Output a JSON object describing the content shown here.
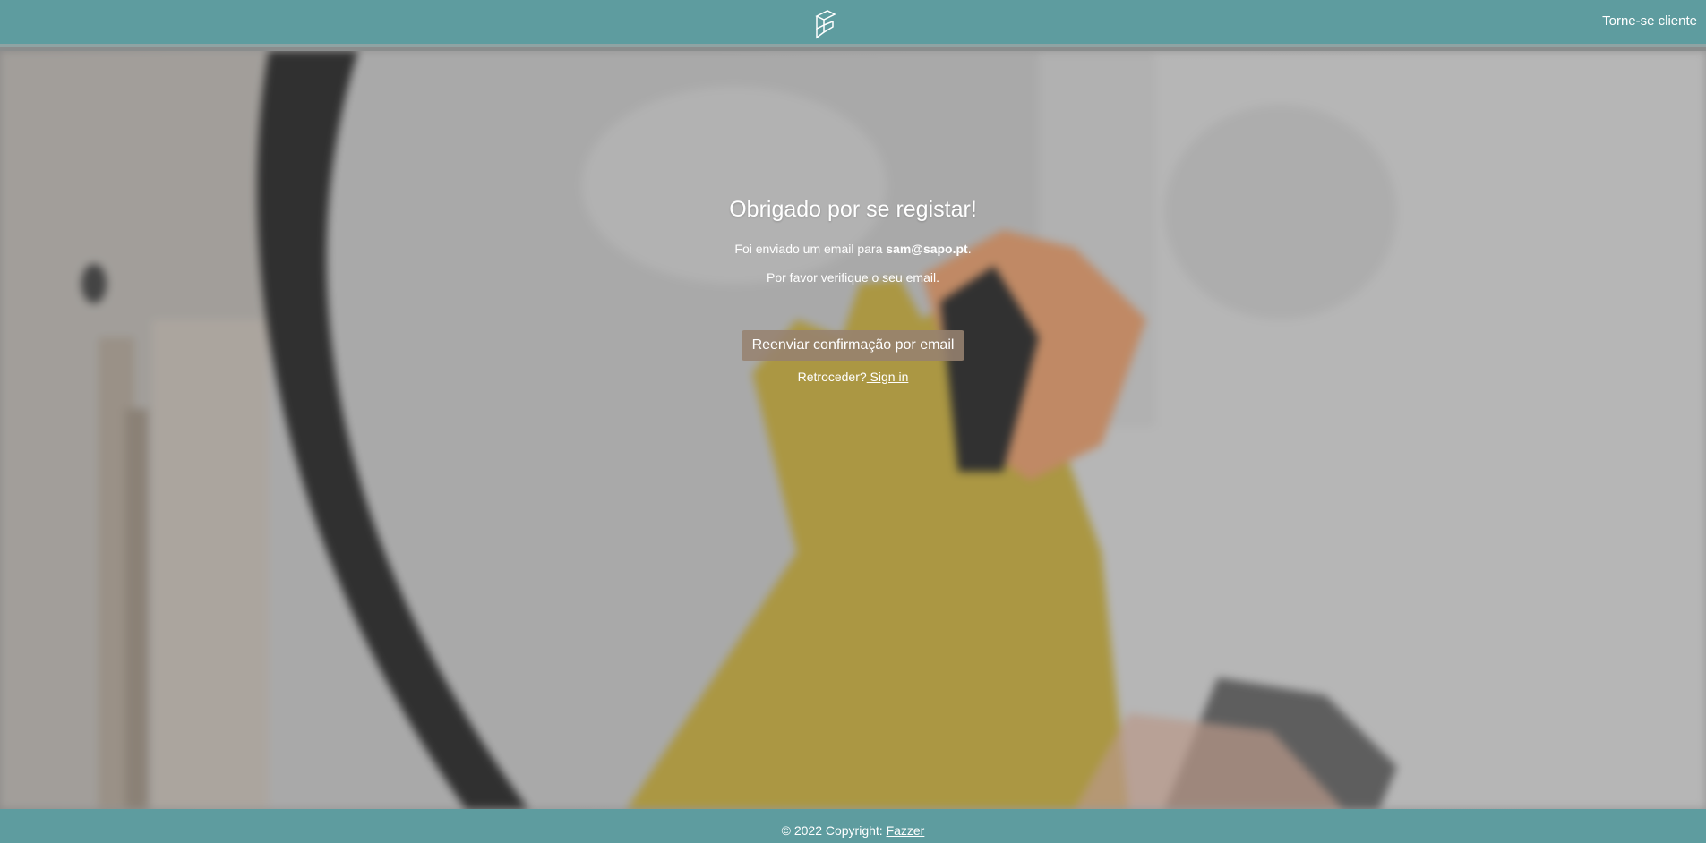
{
  "header": {
    "logo_icon": "fazzer-logo-icon",
    "become_client_link": "Torne-se cliente"
  },
  "main": {
    "title": "Obrigado por se registar!",
    "email_sent_prefix": "Foi enviado um email para ",
    "email": "sam@sapo.pt",
    "email_sent_suffix": ".",
    "verify_text": "Por favor verifique o seu email.",
    "resend_button": "Reenviar confirmação por email",
    "back_prefix": "Retroceder?",
    "sign_in_link": " Sign in"
  },
  "footer": {
    "copyright": "© 2022 Copyright: ",
    "brand_link": "Fazzer"
  },
  "colors": {
    "header_bg": "#5e9c9f",
    "footer_bg": "#5e9c9f",
    "button_bg": "#968270"
  }
}
